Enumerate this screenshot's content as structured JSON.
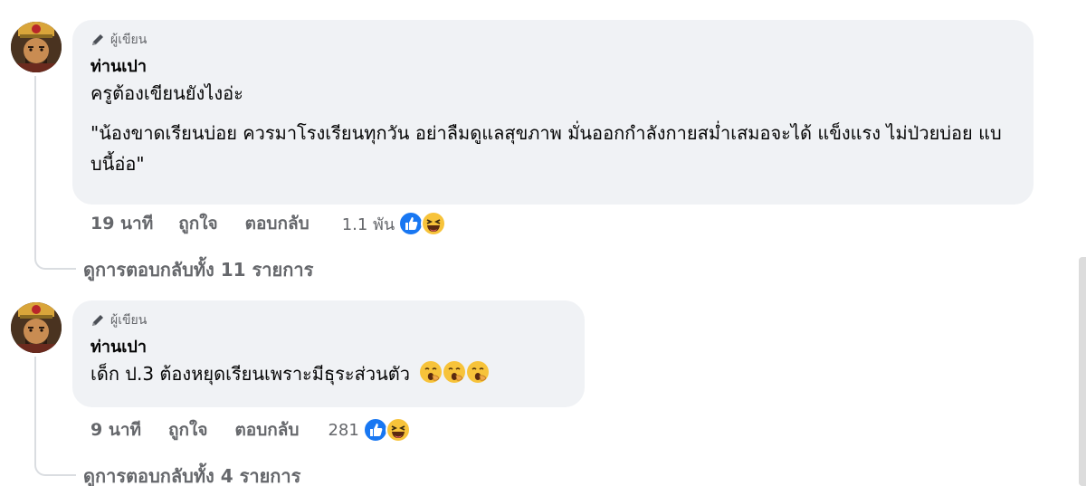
{
  "comments": [
    {
      "badge": "ผู้เขียน",
      "author": "ท่านเปา",
      "line1": "ครูต้องเขียนยังไงอ่ะ",
      "quote": "\"น้องขาดเรียนบ่อย ควรมาโรงเรียนทุกวัน อย่าลืมดูแลสุขภาพ มั่นออกกำลังกายสม่ำเสมอจะได้ แข็งแรง ไม่ป่วยบ่อย แบบนี้อ่อ\"",
      "time": "19 นาที",
      "like": "ถูกใจ",
      "reply": "ตอบกลับ",
      "reaction_count": "1.1 พัน",
      "reaction_icons": [
        "like-icon",
        "haha-icon"
      ],
      "view_replies": "ดูการตอบกลับทั้ง 11 รายการ"
    },
    {
      "badge": "ผู้เขียน",
      "author": "ท่านเปา",
      "line1": "เด็ก ป.3 ต้องหยุดเรียนเพราะมีธุระส่วนตัว",
      "inline_emojis": [
        "yawning-face-icon",
        "yawning-face-icon",
        "yawning-face-icon"
      ],
      "time": "9 นาที",
      "like": "ถูกใจ",
      "reply": "ตอบกลับ",
      "reaction_count": "281",
      "reaction_icons": [
        "like-icon",
        "haha-icon"
      ],
      "view_replies": "ดูการตอบกลับทั้ง 4 รายการ"
    }
  ],
  "colors": {
    "bubble": "#f0f2f5",
    "meta_text": "#65676b",
    "like_blue": "#1877f2",
    "emoji_yellow": "#f7c33a"
  }
}
